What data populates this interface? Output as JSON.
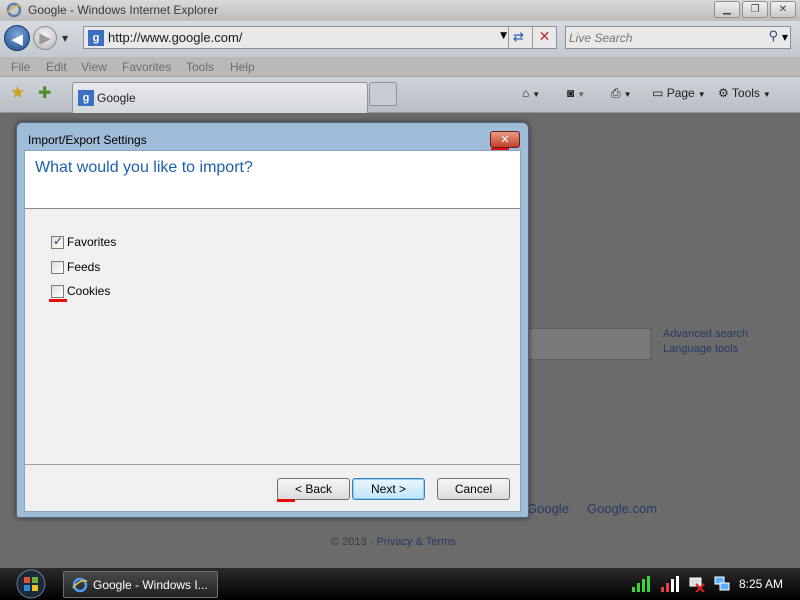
{
  "window": {
    "title": "Google - Windows Internet Explorer"
  },
  "address_bar": {
    "url": "http://www.google.com/",
    "search_placeholder": "Live Search"
  },
  "menu": [
    "File",
    "Edit",
    "View",
    "Favorites",
    "Tools",
    "Help"
  ],
  "tabs": [
    {
      "label": "Google",
      "favicon": "g"
    }
  ],
  "command_bar": {
    "page_label": "Page",
    "tools_label": "Tools"
  },
  "google_page": {
    "advanced_search": "Advanced search",
    "language_tools": "Language tools",
    "footer_link_partial": "Google",
    "footer_link_com": "Google.com",
    "copyright_prefix": "© 2013 - ",
    "privacy_terms": "Privacy & Terms"
  },
  "dialog": {
    "title": "Import/Export Settings",
    "close_glyph": "✕",
    "question": "What would you like to import?",
    "options": [
      {
        "label": "Favorites",
        "checked": true
      },
      {
        "label": "Feeds",
        "checked": false
      },
      {
        "label": "Cookies",
        "checked": false
      }
    ],
    "buttons": {
      "back": "< Back",
      "next": "Next >",
      "cancel": "Cancel"
    }
  },
  "taskbar": {
    "task_label": "Google - Windows I...",
    "clock": "8:25 AM"
  },
  "colors": {
    "dialog_accent": "#1c5eb0",
    "annotation_mark": "#e01010",
    "link": "#263a66"
  }
}
